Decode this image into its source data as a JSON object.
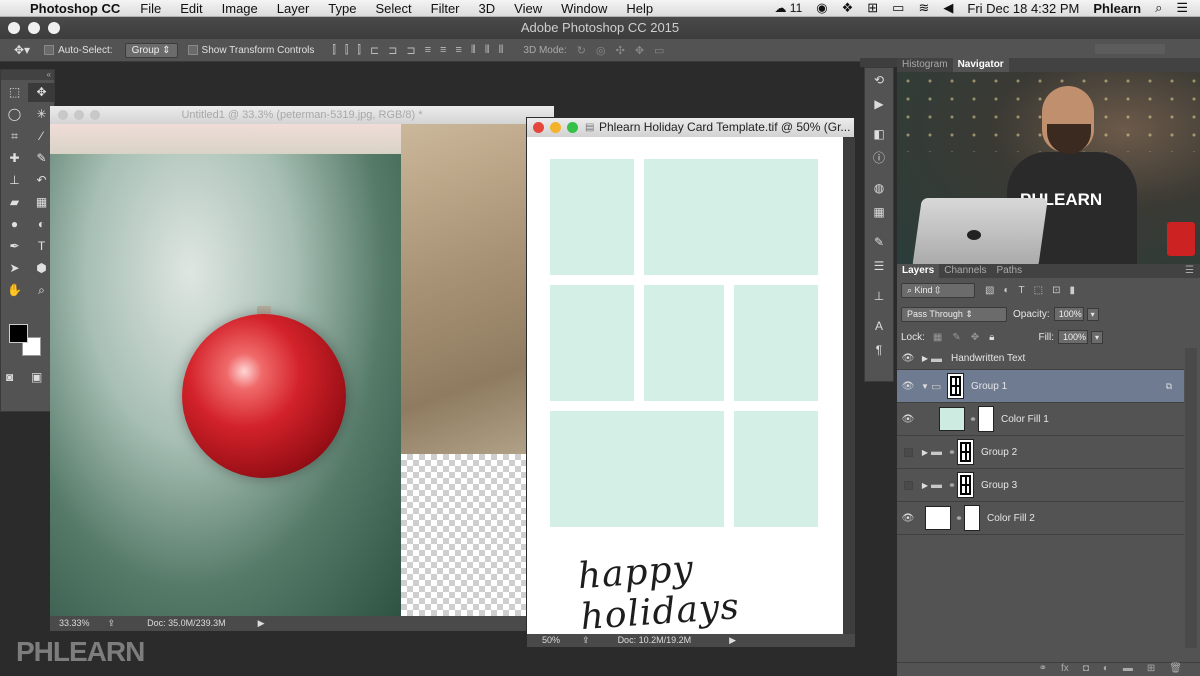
{
  "menubar": {
    "app_name": "Photoshop CC",
    "items": [
      "File",
      "Edit",
      "Image",
      "Layer",
      "Type",
      "Select",
      "Filter",
      "3D",
      "View",
      "Window",
      "Help"
    ],
    "badge": "11",
    "clock": "Fri Dec 18  4:32 PM",
    "user": "Phlearn"
  },
  "window": {
    "title": "Adobe Photoshop CC 2015"
  },
  "options": {
    "auto_select_label": "Auto-Select:",
    "auto_select_value": "Group",
    "transform_controls_label": "Show Transform Controls",
    "mode_3d_label": "3D Mode:"
  },
  "doc1": {
    "title": "Untitled1 @ 33.3% (peterman-5319.jpg, RGB/8) *",
    "zoom": "33.33%",
    "doc_size": "Doc: 35.0M/239.3M"
  },
  "doc2": {
    "title": "Phlearn Holiday Card Template.tif @ 50% (Gr...",
    "zoom": "50%",
    "doc_size": "Doc: 10.2M/19.2M",
    "script_text": "happy holidays"
  },
  "nav_tabs": [
    {
      "label": "Histogram",
      "active": false
    },
    {
      "label": "Navigator",
      "active": true
    }
  ],
  "navigator": {
    "shirt_text": "PHLEARN"
  },
  "layers_tabs": [
    {
      "label": "Layers",
      "active": true
    },
    {
      "label": "Channels",
      "active": false
    },
    {
      "label": "Paths",
      "active": false
    }
  ],
  "layers_panel": {
    "filter_kind": "Kind",
    "blend_mode": "Pass Through",
    "opacity_label": "Opacity:",
    "opacity_value": "100%",
    "lock_label": "Lock:",
    "fill_label": "Fill:",
    "fill_value": "100%"
  },
  "layers": [
    {
      "name": "Handwritten Text",
      "visible": true,
      "type": "group",
      "selected": false
    },
    {
      "name": "Group 1",
      "visible": true,
      "type": "group-open",
      "selected": true
    },
    {
      "name": "Color Fill 1",
      "visible": true,
      "type": "fill",
      "selected": false
    },
    {
      "name": "Group 2",
      "visible": false,
      "type": "group",
      "selected": false
    },
    {
      "name": "Group 3",
      "visible": false,
      "type": "group",
      "selected": false
    },
    {
      "name": "Color Fill 2",
      "visible": true,
      "type": "fill-white",
      "selected": false
    }
  ],
  "watermark": "PHLEARN",
  "colors": {
    "template_box": "#d4efe5",
    "selected_layer": "#6e7b91",
    "panel_bg": "#535353",
    "ornament_red": "#d3222a"
  }
}
